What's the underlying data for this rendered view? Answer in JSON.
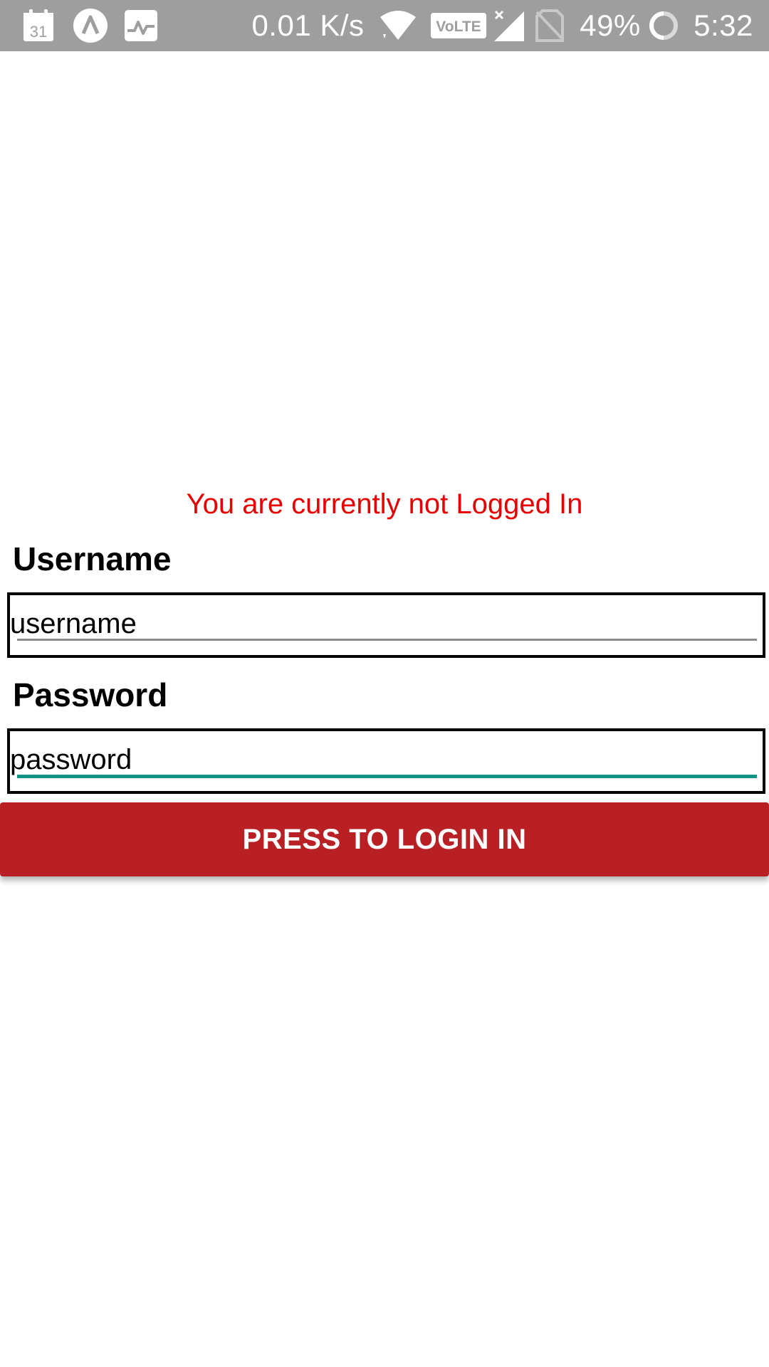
{
  "status_bar": {
    "network_speed": "0.01 K/s",
    "volte": "VoLTE",
    "battery_percent": "49%",
    "time": "5:32",
    "calendar_day": "31",
    "icons": [
      "calendar-icon",
      "app-launcher-icon",
      "activity-monitor-icon",
      "wifi-icon",
      "volte-icon",
      "signal-icon",
      "no-sim-icon",
      "battery-icon"
    ],
    "background_color": "#9e9e9e"
  },
  "login": {
    "status_message": "You are currently not Logged In",
    "status_color": "#e60000",
    "username_label": "Username",
    "username_value": "username",
    "password_label": "Password",
    "password_value": "password",
    "button_label": "PRESS TO LOGIN IN",
    "button_color": "#b92024",
    "focus_color": "#119485"
  }
}
